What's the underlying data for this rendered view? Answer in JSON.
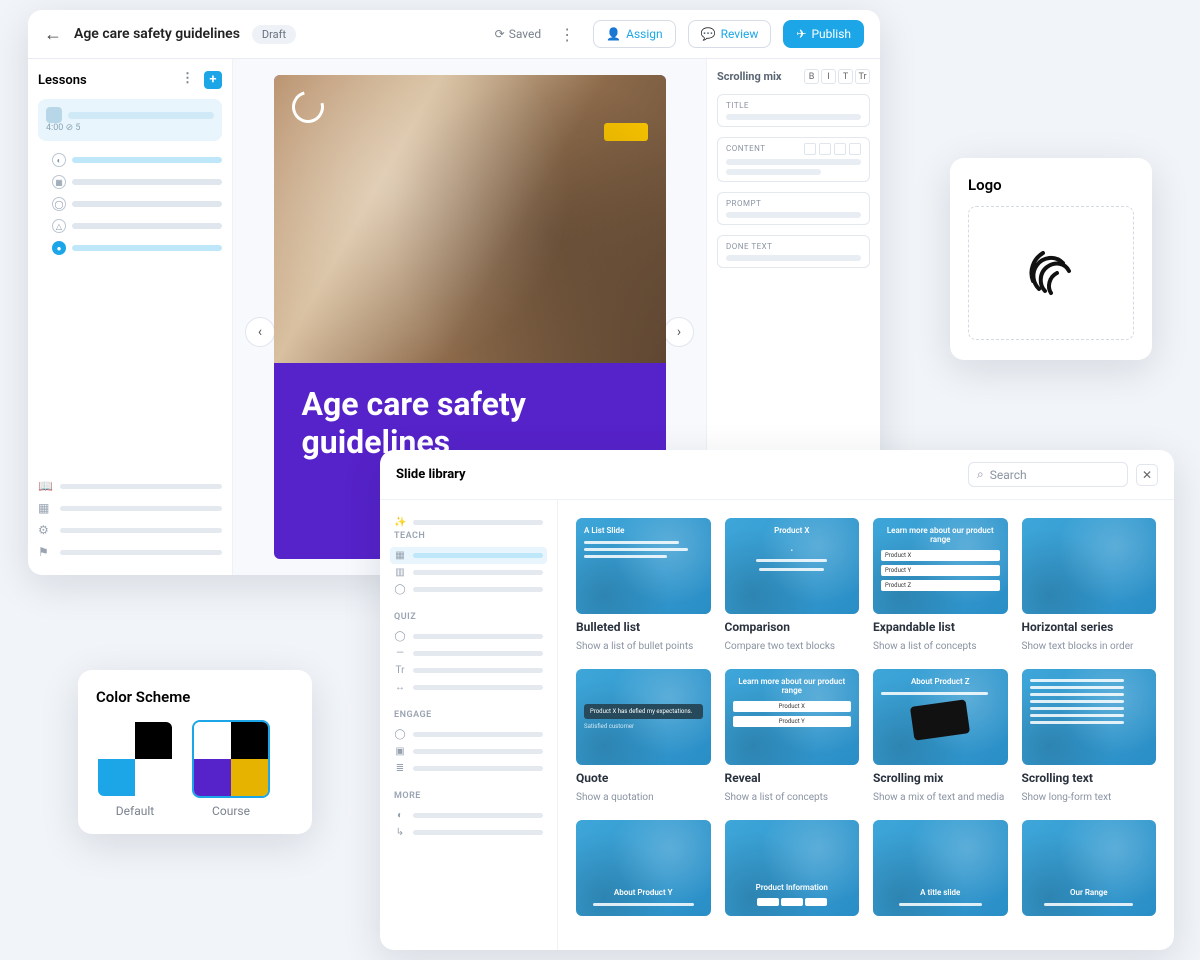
{
  "editor": {
    "back_icon": "←",
    "title": "Age care safety guidelines",
    "status_pill": "Draft",
    "saved_label": "Saved",
    "saved_icon": "⟳",
    "more_icon": "⋮",
    "assign_btn": "Assign",
    "review_btn": "Review",
    "publish_btn": "Publish",
    "lessons": {
      "heading": "Lessons",
      "add_icon": "+",
      "current_meta": "4:00  ⊘ 5",
      "items": [
        {
          "icon": "◐",
          "active": true
        },
        {
          "icon": "▦",
          "active": false
        },
        {
          "icon": "◯",
          "active": false
        },
        {
          "icon": "△",
          "active": false
        },
        {
          "icon": "●",
          "active_dot": true
        }
      ],
      "footer_icons": [
        "📖",
        "▦",
        "⚙",
        "⚑"
      ]
    },
    "slide": {
      "title": "Age care safety guidelines"
    },
    "nav_prev": "‹",
    "nav_next": "›",
    "props": {
      "heading": "Scrolling mix",
      "fmt": [
        "B",
        "I",
        "T",
        "Tr"
      ],
      "fields": [
        {
          "label": "TITLE"
        },
        {
          "label": "CONTENT",
          "tools": true
        },
        {
          "label": "PROMPT"
        },
        {
          "label": "DONE TEXT"
        }
      ]
    }
  },
  "logo_card": {
    "heading": "Logo"
  },
  "scheme": {
    "heading": "Color Scheme",
    "options": [
      {
        "label": "Default",
        "colors": [
          "#ffffff",
          "#000000",
          "#1ca6e8",
          "#ffffff"
        ],
        "selected": false
      },
      {
        "label": "Course",
        "colors": [
          "#ffffff",
          "#000000",
          "#5622c9",
          "#e6b400"
        ],
        "selected": true
      }
    ]
  },
  "library": {
    "heading": "Slide library",
    "search_placeholder": "Search",
    "search_icon": "⌕",
    "close_icon": "✕",
    "sidebar": {
      "top_icon": "✨",
      "groups": [
        {
          "title": "TEACH",
          "rows": [
            {
              "icon": "▦",
              "active": true
            },
            {
              "icon": "▥"
            },
            {
              "icon": "◯"
            }
          ]
        },
        {
          "title": "QUIZ",
          "rows": [
            {
              "icon": "◯"
            },
            {
              "icon": "—"
            },
            {
              "icon": "Tr"
            },
            {
              "icon": "↔"
            }
          ]
        },
        {
          "title": "ENGAGE",
          "rows": [
            {
              "icon": "◯"
            },
            {
              "icon": "▣"
            },
            {
              "icon": "≣"
            }
          ]
        },
        {
          "title": "MORE",
          "rows": [
            {
              "icon": "◐"
            },
            {
              "icon": "↳"
            }
          ]
        }
      ]
    },
    "templates_row1": [
      {
        "name": "Bulleted list",
        "desc": "Show a list of bullet points",
        "thumb": {
          "title": "A List Slide",
          "bullets": 3
        }
      },
      {
        "name": "Comparison",
        "desc": "Compare two text blocks",
        "thumb": {
          "title": "Product X",
          "center": true
        }
      },
      {
        "name": "Expandable list",
        "desc": "Show a list of concepts",
        "thumb": {
          "title": "Learn more about our product range",
          "boxes": [
            "Product X",
            "Product Y",
            "Product Z"
          ]
        }
      },
      {
        "name": "Horizontal series",
        "desc": "Show text blocks in order",
        "thumb": {}
      }
    ],
    "templates_row2": [
      {
        "name": "Quote",
        "desc": "Show a quotation",
        "thumb": {
          "quote": "Product X has defied my expectations.",
          "author": "Satisfied customer"
        }
      },
      {
        "name": "Reveal",
        "desc": "Show a list of concepts",
        "thumb": {
          "title": "Learn more about our product range",
          "boxes": [
            "Product X",
            "Product Y"
          ]
        }
      },
      {
        "name": "Scrolling mix",
        "desc": "Show a mix of text and media",
        "thumb": {
          "title": "About Product Z",
          "card": true
        }
      },
      {
        "name": "Scrolling text",
        "desc": "Show long-form text",
        "thumb": {
          "dense": true
        }
      }
    ],
    "templates_row3": [
      {
        "name": "",
        "desc": "",
        "thumb": {
          "title": "About Product Y"
        }
      },
      {
        "name": "",
        "desc": "",
        "thumb": {
          "title": "Product Information",
          "table": true
        }
      },
      {
        "name": "",
        "desc": "",
        "thumb": {
          "title": "A title slide"
        }
      },
      {
        "name": "",
        "desc": "",
        "thumb": {
          "title": "Our Range"
        }
      }
    ]
  }
}
